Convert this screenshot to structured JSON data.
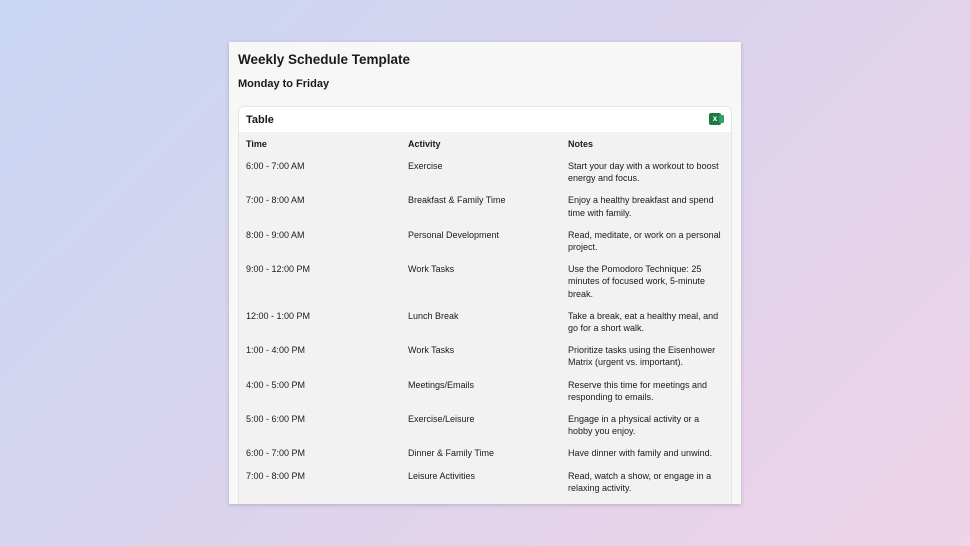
{
  "document": {
    "title": "Weekly Schedule Template",
    "subtitle": "Monday to Friday"
  },
  "card": {
    "title": "Table",
    "export_icon": "excel-icon"
  },
  "table": {
    "headers": [
      "Time",
      "Activity",
      "Notes"
    ],
    "rows": [
      [
        "6:00 - 7:00 AM",
        "Exercise",
        "Start your day with a workout to boost energy and focus."
      ],
      [
        "7:00 - 8:00 AM",
        "Breakfast & Family Time",
        "Enjoy a healthy breakfast and spend time with family."
      ],
      [
        "8:00 - 9:00 AM",
        "Personal Development",
        "Read, meditate, or work on a personal project."
      ],
      [
        "9:00 - 12:00 PM",
        "Work Tasks",
        "Use the Pomodoro Technique: 25 minutes of focused work, 5-minute break."
      ],
      [
        "12:00 - 1:00 PM",
        "Lunch Break",
        "Take a break, eat a healthy meal, and go for a short walk."
      ],
      [
        "1:00 - 4:00 PM",
        "Work Tasks",
        "Prioritize tasks using the Eisenhower Matrix (urgent vs. important)."
      ],
      [
        "4:00 - 5:00 PM",
        "Meetings/Emails",
        "Reserve this time for meetings and responding to emails."
      ],
      [
        "5:00 - 6:00 PM",
        "Exercise/Leisure",
        "Engage in a physical activity or a hobby you enjoy."
      ],
      [
        "6:00 - 7:00 PM",
        "Dinner & Family Time",
        "Have dinner with family and unwind."
      ],
      [
        "7:00 - 8:00 PM",
        "Leisure Activities",
        "Read, watch a show, or engage in a relaxing activity."
      ]
    ]
  }
}
